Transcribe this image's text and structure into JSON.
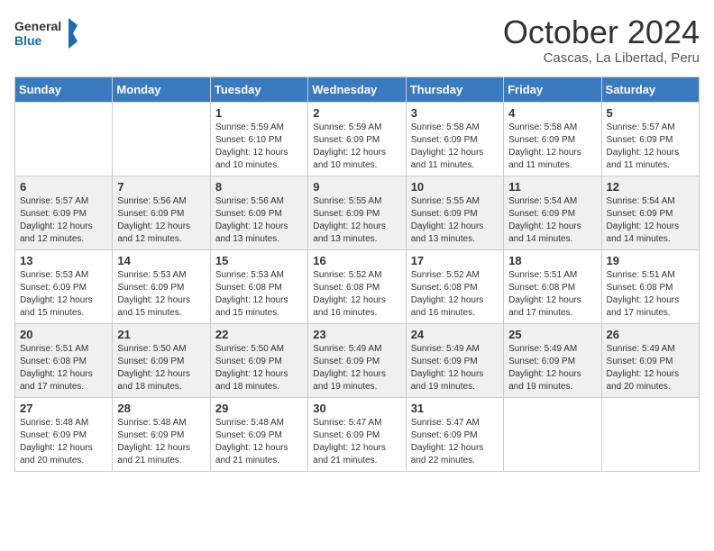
{
  "logo": {
    "line1": "General",
    "line2": "Blue"
  },
  "title": "October 2024",
  "location": "Cascas, La Libertad, Peru",
  "weekdays": [
    "Sunday",
    "Monday",
    "Tuesday",
    "Wednesday",
    "Thursday",
    "Friday",
    "Saturday"
  ],
  "weeks": [
    [
      {
        "day": "",
        "info": ""
      },
      {
        "day": "",
        "info": ""
      },
      {
        "day": "1",
        "info": "Sunrise: 5:59 AM\nSunset: 6:10 PM\nDaylight: 12 hours\nand 10 minutes."
      },
      {
        "day": "2",
        "info": "Sunrise: 5:59 AM\nSunset: 6:09 PM\nDaylight: 12 hours\nand 10 minutes."
      },
      {
        "day": "3",
        "info": "Sunrise: 5:58 AM\nSunset: 6:09 PM\nDaylight: 12 hours\nand 11 minutes."
      },
      {
        "day": "4",
        "info": "Sunrise: 5:58 AM\nSunset: 6:09 PM\nDaylight: 12 hours\nand 11 minutes."
      },
      {
        "day": "5",
        "info": "Sunrise: 5:57 AM\nSunset: 6:09 PM\nDaylight: 12 hours\nand 11 minutes."
      }
    ],
    [
      {
        "day": "6",
        "info": "Sunrise: 5:57 AM\nSunset: 6:09 PM\nDaylight: 12 hours\nand 12 minutes."
      },
      {
        "day": "7",
        "info": "Sunrise: 5:56 AM\nSunset: 6:09 PM\nDaylight: 12 hours\nand 12 minutes."
      },
      {
        "day": "8",
        "info": "Sunrise: 5:56 AM\nSunset: 6:09 PM\nDaylight: 12 hours\nand 13 minutes."
      },
      {
        "day": "9",
        "info": "Sunrise: 5:55 AM\nSunset: 6:09 PM\nDaylight: 12 hours\nand 13 minutes."
      },
      {
        "day": "10",
        "info": "Sunrise: 5:55 AM\nSunset: 6:09 PM\nDaylight: 12 hours\nand 13 minutes."
      },
      {
        "day": "11",
        "info": "Sunrise: 5:54 AM\nSunset: 6:09 PM\nDaylight: 12 hours\nand 14 minutes."
      },
      {
        "day": "12",
        "info": "Sunrise: 5:54 AM\nSunset: 6:09 PM\nDaylight: 12 hours\nand 14 minutes."
      }
    ],
    [
      {
        "day": "13",
        "info": "Sunrise: 5:53 AM\nSunset: 6:09 PM\nDaylight: 12 hours\nand 15 minutes."
      },
      {
        "day": "14",
        "info": "Sunrise: 5:53 AM\nSunset: 6:09 PM\nDaylight: 12 hours\nand 15 minutes."
      },
      {
        "day": "15",
        "info": "Sunrise: 5:53 AM\nSunset: 6:08 PM\nDaylight: 12 hours\nand 15 minutes."
      },
      {
        "day": "16",
        "info": "Sunrise: 5:52 AM\nSunset: 6:08 PM\nDaylight: 12 hours\nand 16 minutes."
      },
      {
        "day": "17",
        "info": "Sunrise: 5:52 AM\nSunset: 6:08 PM\nDaylight: 12 hours\nand 16 minutes."
      },
      {
        "day": "18",
        "info": "Sunrise: 5:51 AM\nSunset: 6:08 PM\nDaylight: 12 hours\nand 17 minutes."
      },
      {
        "day": "19",
        "info": "Sunrise: 5:51 AM\nSunset: 6:08 PM\nDaylight: 12 hours\nand 17 minutes."
      }
    ],
    [
      {
        "day": "20",
        "info": "Sunrise: 5:51 AM\nSunset: 6:08 PM\nDaylight: 12 hours\nand 17 minutes."
      },
      {
        "day": "21",
        "info": "Sunrise: 5:50 AM\nSunset: 6:09 PM\nDaylight: 12 hours\nand 18 minutes."
      },
      {
        "day": "22",
        "info": "Sunrise: 5:50 AM\nSunset: 6:09 PM\nDaylight: 12 hours\nand 18 minutes."
      },
      {
        "day": "23",
        "info": "Sunrise: 5:49 AM\nSunset: 6:09 PM\nDaylight: 12 hours\nand 19 minutes."
      },
      {
        "day": "24",
        "info": "Sunrise: 5:49 AM\nSunset: 6:09 PM\nDaylight: 12 hours\nand 19 minutes."
      },
      {
        "day": "25",
        "info": "Sunrise: 5:49 AM\nSunset: 6:09 PM\nDaylight: 12 hours\nand 19 minutes."
      },
      {
        "day": "26",
        "info": "Sunrise: 5:49 AM\nSunset: 6:09 PM\nDaylight: 12 hours\nand 20 minutes."
      }
    ],
    [
      {
        "day": "27",
        "info": "Sunrise: 5:48 AM\nSunset: 6:09 PM\nDaylight: 12 hours\nand 20 minutes."
      },
      {
        "day": "28",
        "info": "Sunrise: 5:48 AM\nSunset: 6:09 PM\nDaylight: 12 hours\nand 21 minutes."
      },
      {
        "day": "29",
        "info": "Sunrise: 5:48 AM\nSunset: 6:09 PM\nDaylight: 12 hours\nand 21 minutes."
      },
      {
        "day": "30",
        "info": "Sunrise: 5:47 AM\nSunset: 6:09 PM\nDaylight: 12 hours\nand 21 minutes."
      },
      {
        "day": "31",
        "info": "Sunrise: 5:47 AM\nSunset: 6:09 PM\nDaylight: 12 hours\nand 22 minutes."
      },
      {
        "day": "",
        "info": ""
      },
      {
        "day": "",
        "info": ""
      }
    ]
  ]
}
